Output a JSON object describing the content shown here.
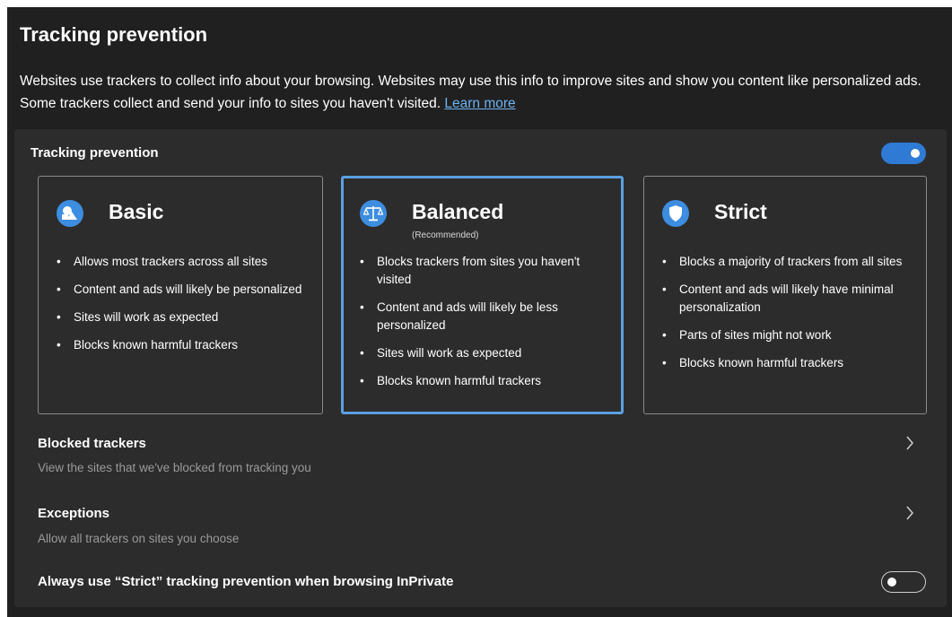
{
  "header": {
    "title": "Tracking prevention",
    "description": "Websites use trackers to collect info about your browsing. Websites may use this info to improve sites and show you content like personalized ads. Some trackers collect and send your info to sites you haven't visited.",
    "learn_more": "Learn more"
  },
  "tracking_prevention": {
    "label": "Tracking prevention",
    "enabled": true
  },
  "cards": [
    {
      "title": "Basic",
      "subtitle": "",
      "icon": "basic-shapes-icon",
      "selected": false,
      "bullets": [
        "Allows most trackers across all sites",
        "Content and ads will likely be personalized",
        "Sites will work as expected",
        "Blocks known harmful trackers"
      ]
    },
    {
      "title": "Balanced",
      "subtitle": "(Recommended)",
      "icon": "balance-scale-icon",
      "selected": true,
      "bullets": [
        "Blocks trackers from sites you haven't visited",
        "Content and ads will likely be less personalized",
        "Sites will work as expected",
        "Blocks known harmful trackers"
      ]
    },
    {
      "title": "Strict",
      "subtitle": "",
      "icon": "shield-icon",
      "selected": false,
      "bullets": [
        "Blocks a majority of trackers from all sites",
        "Content and ads will likely have minimal personalization",
        "Parts of sites might not work",
        "Blocks known harmful trackers"
      ]
    }
  ],
  "blocked_trackers": {
    "title": "Blocked trackers",
    "subtitle": "View the sites that we've blocked from tracking you"
  },
  "exceptions": {
    "title": "Exceptions",
    "subtitle": "Allow all trackers on sites you choose"
  },
  "inprivate": {
    "label": "Always use “Strict” tracking prevention when browsing InPrivate",
    "enabled": false
  },
  "colors": {
    "background": "#202020",
    "panel": "#2c2c2c",
    "accent": "#2f7ad5",
    "link": "#6cb3f2",
    "selected_border": "#5aa0e0"
  }
}
